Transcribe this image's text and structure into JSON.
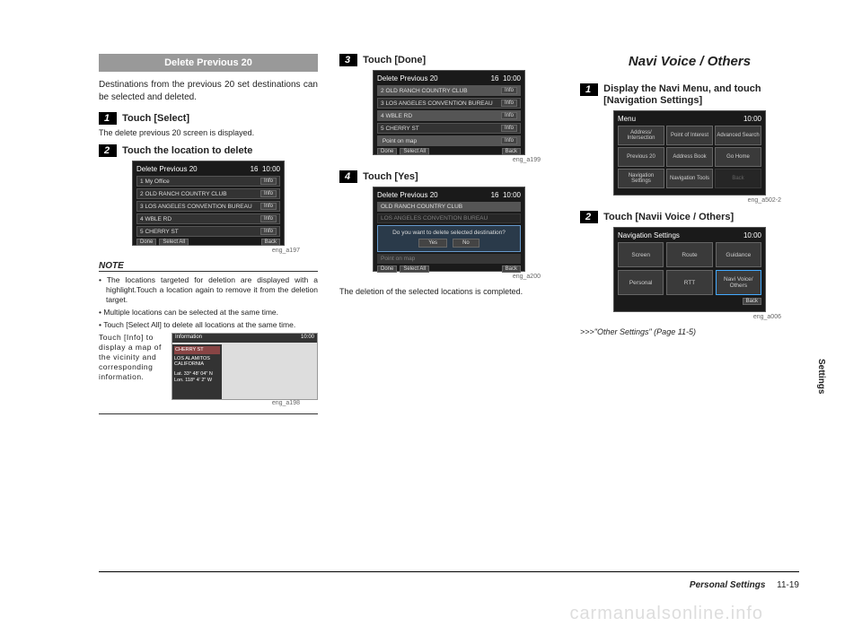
{
  "col1": {
    "section_title": "Delete Previous 20",
    "intro": "Destinations from the previous 20 set destinations can be selected and deleted.",
    "step1": {
      "num": "1",
      "label": "Touch [Select]"
    },
    "step1_sub": "The delete previous 20 screen is displayed.",
    "step2": {
      "num": "2",
      "label": "Touch the location to delete"
    },
    "shot1": {
      "title": "Delete Previous 20",
      "count": "16",
      "time": "10:00",
      "rows": [
        {
          "n": "1",
          "label": "My Office",
          "btn": "Info"
        },
        {
          "n": "2",
          "label": "OLD RANCH COUNTRY CLUB",
          "btn": "Info"
        },
        {
          "n": "3",
          "label": "LOS ANGELES CONVENTION BUREAU",
          "btn": "Info"
        },
        {
          "n": "4",
          "label": "WBLE RD",
          "btn": "Info"
        },
        {
          "n": "5",
          "label": "CHERRY ST",
          "btn": "Info"
        }
      ],
      "footer": [
        "Done",
        "Select All",
        "Back"
      ]
    },
    "cap1": "eng_a197",
    "note_head": "NOTE",
    "notes": [
      "The locations targeted for deletion are displayed with a highlight.Touch a location again to remove it from the deletion target.",
      "Multiple locations can be selected at the same time.",
      "Touch [Select All] to delete all locations at the same time."
    ],
    "note_info": "Touch [Info] to display a map of the vicinity and corresponding information.",
    "map": {
      "title": "Information",
      "time": "10:00",
      "loc": "CHERRY ST",
      "city": "LOS ALAMITOS\nCALIFORNIA",
      "lat": "Lat.  33° 48' 04\" N",
      "lon": "Lon. 118°  4'  2\"  W"
    },
    "cap_map": "eng_a198"
  },
  "col2": {
    "step3": {
      "num": "3",
      "label": "Touch [Done]"
    },
    "shot3": {
      "title": "Delete Previous 20",
      "count": "16",
      "time": "10:00",
      "rows": [
        {
          "n": "2",
          "label": "OLD RANCH COUNTRY CLUB",
          "btn": "Info",
          "hl": true
        },
        {
          "n": "3",
          "label": "LOS ANGELES CONVENTION BUREAU",
          "btn": "Info"
        },
        {
          "n": "4",
          "label": "WBLE RD",
          "btn": "Info",
          "hl": true
        },
        {
          "n": "5",
          "label": "CHERRY ST",
          "btn": "Info"
        },
        {
          "n": "",
          "label": "Point on map",
          "btn": "Info",
          "hl": true
        }
      ],
      "footer": [
        "Done",
        "Select All",
        "Back"
      ]
    },
    "cap3": "eng_a199",
    "step4": {
      "num": "4",
      "label": "Touch [Yes]"
    },
    "shot4": {
      "title": "Delete Previous 20",
      "count": "16",
      "time": "10:00",
      "row_top": "OLD RANCH COUNTRY CLUB",
      "row_top2": "LOS ANGELES CONVENTION BUREAU",
      "dialog": "Do you want to delete selected destination?",
      "yes": "Yes",
      "no": "No",
      "row_bottom": "Point on map",
      "footer": [
        "Done",
        "Select All",
        "Back"
      ]
    },
    "cap4": "eng_a200",
    "result": "The deletion of the selected locations is completed."
  },
  "col3": {
    "heading": "Navi Voice / Others",
    "step1": {
      "num": "1",
      "label": "Display the Navi Menu, and touch [Navigation Settings]"
    },
    "menu": {
      "title": "Menu",
      "time": "10:00",
      "cells": [
        "Address/\nIntersection",
        "Point of\nInterest",
        "Advanced\nSearch",
        "Previous\n20",
        "Address\nBook",
        "Go Home",
        "Navigation\nSettings",
        "Navigation\nTools",
        "Back"
      ]
    },
    "cap_menu": "eng_a502-2",
    "step2": {
      "num": "2",
      "label": "Touch [Navii Voice / Others]"
    },
    "settings": {
      "title": "Navigation Settings",
      "time": "10:00",
      "cells": [
        "Screen",
        "Route",
        "Guidance",
        "Personal",
        "RTT",
        "Navi Voice/\nOthers"
      ],
      "back": "Back"
    },
    "cap_settings": "eng_a006",
    "ref": ">>>\"Other Settings\" (Page 11-5)"
  },
  "tab": "Settings",
  "footer": {
    "section": "Personal Settings",
    "page": "11-19"
  },
  "watermark": "carmanualsonline.info"
}
